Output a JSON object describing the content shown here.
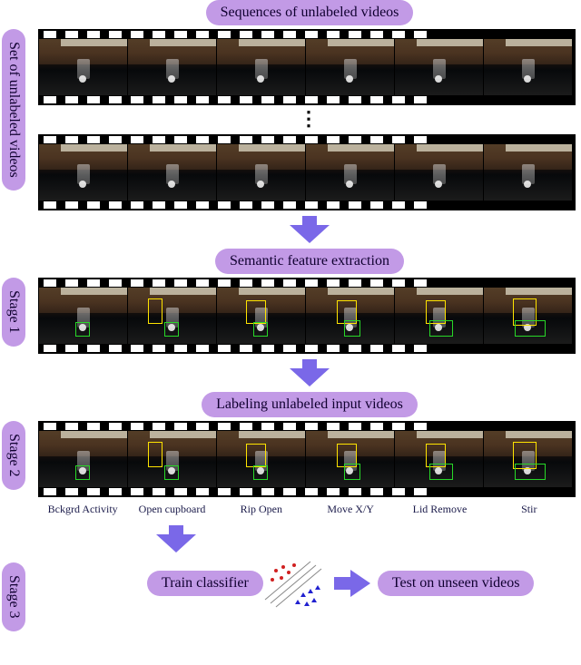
{
  "labels": {
    "side_set": "Set of unlabeled videos",
    "side_stage1": "Stage 1",
    "side_stage2": "Stage 2",
    "side_stage3": "Stage 3",
    "top": "Sequences of unlabeled videos",
    "semantic": "Semantic feature extraction",
    "labeling": "Labeling unlabeled input videos",
    "train": "Train classifier",
    "test": "Test on unseen videos"
  },
  "activities": [
    "Bckgrd Activity",
    "Open cupboard",
    "Rip Open",
    "Move X/Y",
    "Lid Remove",
    "Stir"
  ],
  "colors": {
    "accent_pill": "#c29ae6",
    "arrow": "#7a68e8",
    "bbox_primary": "#ffe400",
    "bbox_secondary": "#28d828",
    "scatter_red": "#d02020",
    "scatter_blue": "#2020d0"
  }
}
